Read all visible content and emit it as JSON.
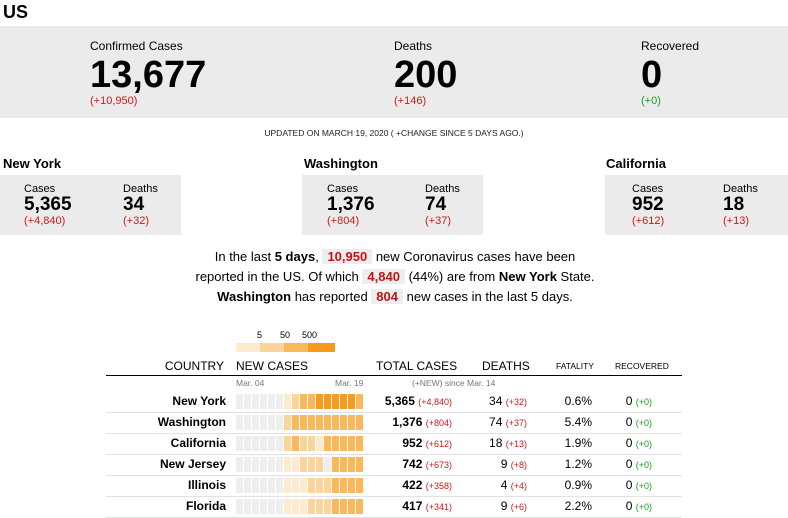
{
  "page_title": "US",
  "totals": {
    "confirmed_label": "Confirmed Cases",
    "confirmed": "13,677",
    "confirmed_change": "(+10,950)",
    "deaths_label": "Deaths",
    "deaths": "200",
    "deaths_change": "(+146)",
    "recovered_label": "Recovered",
    "recovered": "0",
    "recovered_change": "(+0)"
  },
  "updated_text": "UPDATED ON MARCH 19, 2020 ( +CHANGE SINCE 5 DAYS AGO.)",
  "states": [
    {
      "name": "New York",
      "cases_label": "Cases",
      "cases": "5,365",
      "cases_change": "(+4,840)",
      "deaths_label": "Deaths",
      "deaths": "34",
      "deaths_change": "(+32)"
    },
    {
      "name": "Washington",
      "cases_label": "Cases",
      "cases": "1,376",
      "cases_change": "(+804)",
      "deaths_label": "Deaths",
      "deaths": "74",
      "deaths_change": "(+37)"
    },
    {
      "name": "California",
      "cases_label": "Cases",
      "cases": "952",
      "cases_change": "(+612)",
      "deaths_label": "Deaths",
      "deaths": "18",
      "deaths_change": "(+13)"
    }
  ],
  "summary": {
    "p1": "In the last ",
    "days": "5 days",
    "p2": ", ",
    "new_cases": "10,950",
    "p3": " new Coronavirus cases have been reported in the US. Of which ",
    "top_state_cases": "4,840",
    "p4": " (44%) are from ",
    "top_state": "New York",
    "p5": " State. ",
    "second_state": "Washington",
    "p6": " has reported ",
    "second_state_cases": "804",
    "p7": " new cases in the last 5 days."
  },
  "legend": {
    "labels": [
      "5",
      "50",
      "500"
    ],
    "colors": [
      "#fdebd0",
      "#fbd49a",
      "#f9b85a",
      "#f79a1e"
    ]
  },
  "table": {
    "headers": {
      "country": "COUNTRY",
      "new_cases": "NEW CASES",
      "total_cases": "TOTAL CASES",
      "deaths": "DEATHS",
      "fatality": "FATALITY",
      "recovered": "RECOVERED"
    },
    "date_start": "Mar. 04",
    "date_end": "Mar. 19",
    "new_since": "(+NEW) since Mar. 14",
    "rows": [
      {
        "name": "New York",
        "total": "5,365",
        "total_new": "(+4,840)",
        "deaths": "34",
        "deaths_new": "(+32)",
        "fatality": "0.6%",
        "recovered": "0",
        "recovered_new": "(+0)",
        "levels": [
          0,
          0,
          0,
          0,
          0,
          0,
          1,
          2,
          3,
          3,
          4,
          4,
          4,
          4,
          4,
          3
        ]
      },
      {
        "name": "Washington",
        "total": "1,376",
        "total_new": "(+804)",
        "deaths": "74",
        "deaths_new": "(+37)",
        "fatality": "5.4%",
        "recovered": "0",
        "recovered_new": "(+0)",
        "levels": [
          0,
          0,
          0,
          0,
          0,
          0,
          2,
          3,
          3,
          3,
          3,
          3,
          3,
          3,
          3,
          3
        ]
      },
      {
        "name": "California",
        "total": "952",
        "total_new": "(+612)",
        "deaths": "18",
        "deaths_new": "(+13)",
        "fatality": "1.9%",
        "recovered": "0",
        "recovered_new": "(+0)",
        "levels": [
          0,
          0,
          0,
          0,
          0,
          0,
          2,
          3,
          2,
          2,
          1,
          3,
          3,
          3,
          3,
          3
        ]
      },
      {
        "name": "New Jersey",
        "total": "742",
        "total_new": "(+673)",
        "deaths": "9",
        "deaths_new": "(+8)",
        "fatality": "1.2%",
        "recovered": "0",
        "recovered_new": "(+0)",
        "levels": [
          0,
          0,
          0,
          0,
          0,
          0,
          1,
          1,
          2,
          2,
          2,
          0,
          3,
          3,
          3,
          3
        ]
      },
      {
        "name": "Illinois",
        "total": "422",
        "total_new": "(+358)",
        "deaths": "4",
        "deaths_new": "(+4)",
        "fatality": "0.9%",
        "recovered": "0",
        "recovered_new": "(+0)",
        "levels": [
          0,
          0,
          0,
          0,
          0,
          0,
          1,
          1,
          1,
          2,
          2,
          2,
          3,
          3,
          3,
          3
        ]
      },
      {
        "name": "Florida",
        "total": "417",
        "total_new": "(+341)",
        "deaths": "9",
        "deaths_new": "(+6)",
        "fatality": "2.2%",
        "recovered": "0",
        "recovered_new": "(+0)",
        "levels": [
          0,
          0,
          0,
          0,
          0,
          0,
          1,
          1,
          1,
          2,
          2,
          2,
          3,
          3,
          3,
          3
        ]
      }
    ]
  },
  "bar_colors": [
    "#eeeeee",
    "#fdebd0",
    "#fbd49a",
    "#f9b85a",
    "#f79a1e"
  ]
}
